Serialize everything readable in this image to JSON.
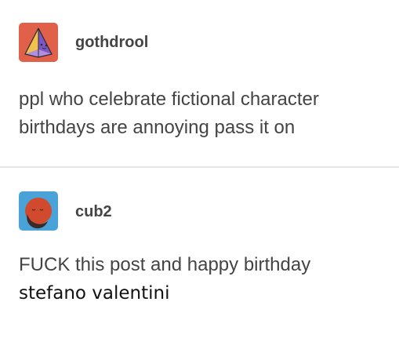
{
  "posts": [
    {
      "username": "gothdrool",
      "avatar_icon": "pyramid-face-icon",
      "avatar_bg": "#e0604a",
      "lines": [
        "ppl who celebrate fictional character",
        "birthdays are annoying pass it on"
      ]
    },
    {
      "username": "cub2",
      "avatar_icon": "sleeping-moon-icon",
      "avatar_bg": "#4aa3d8",
      "lines": [
        "FUCK this post and happy birthday",
        "stefano valentini"
      ]
    }
  ],
  "colors": {
    "text": "#444444",
    "divider": "#e6e6e6"
  }
}
